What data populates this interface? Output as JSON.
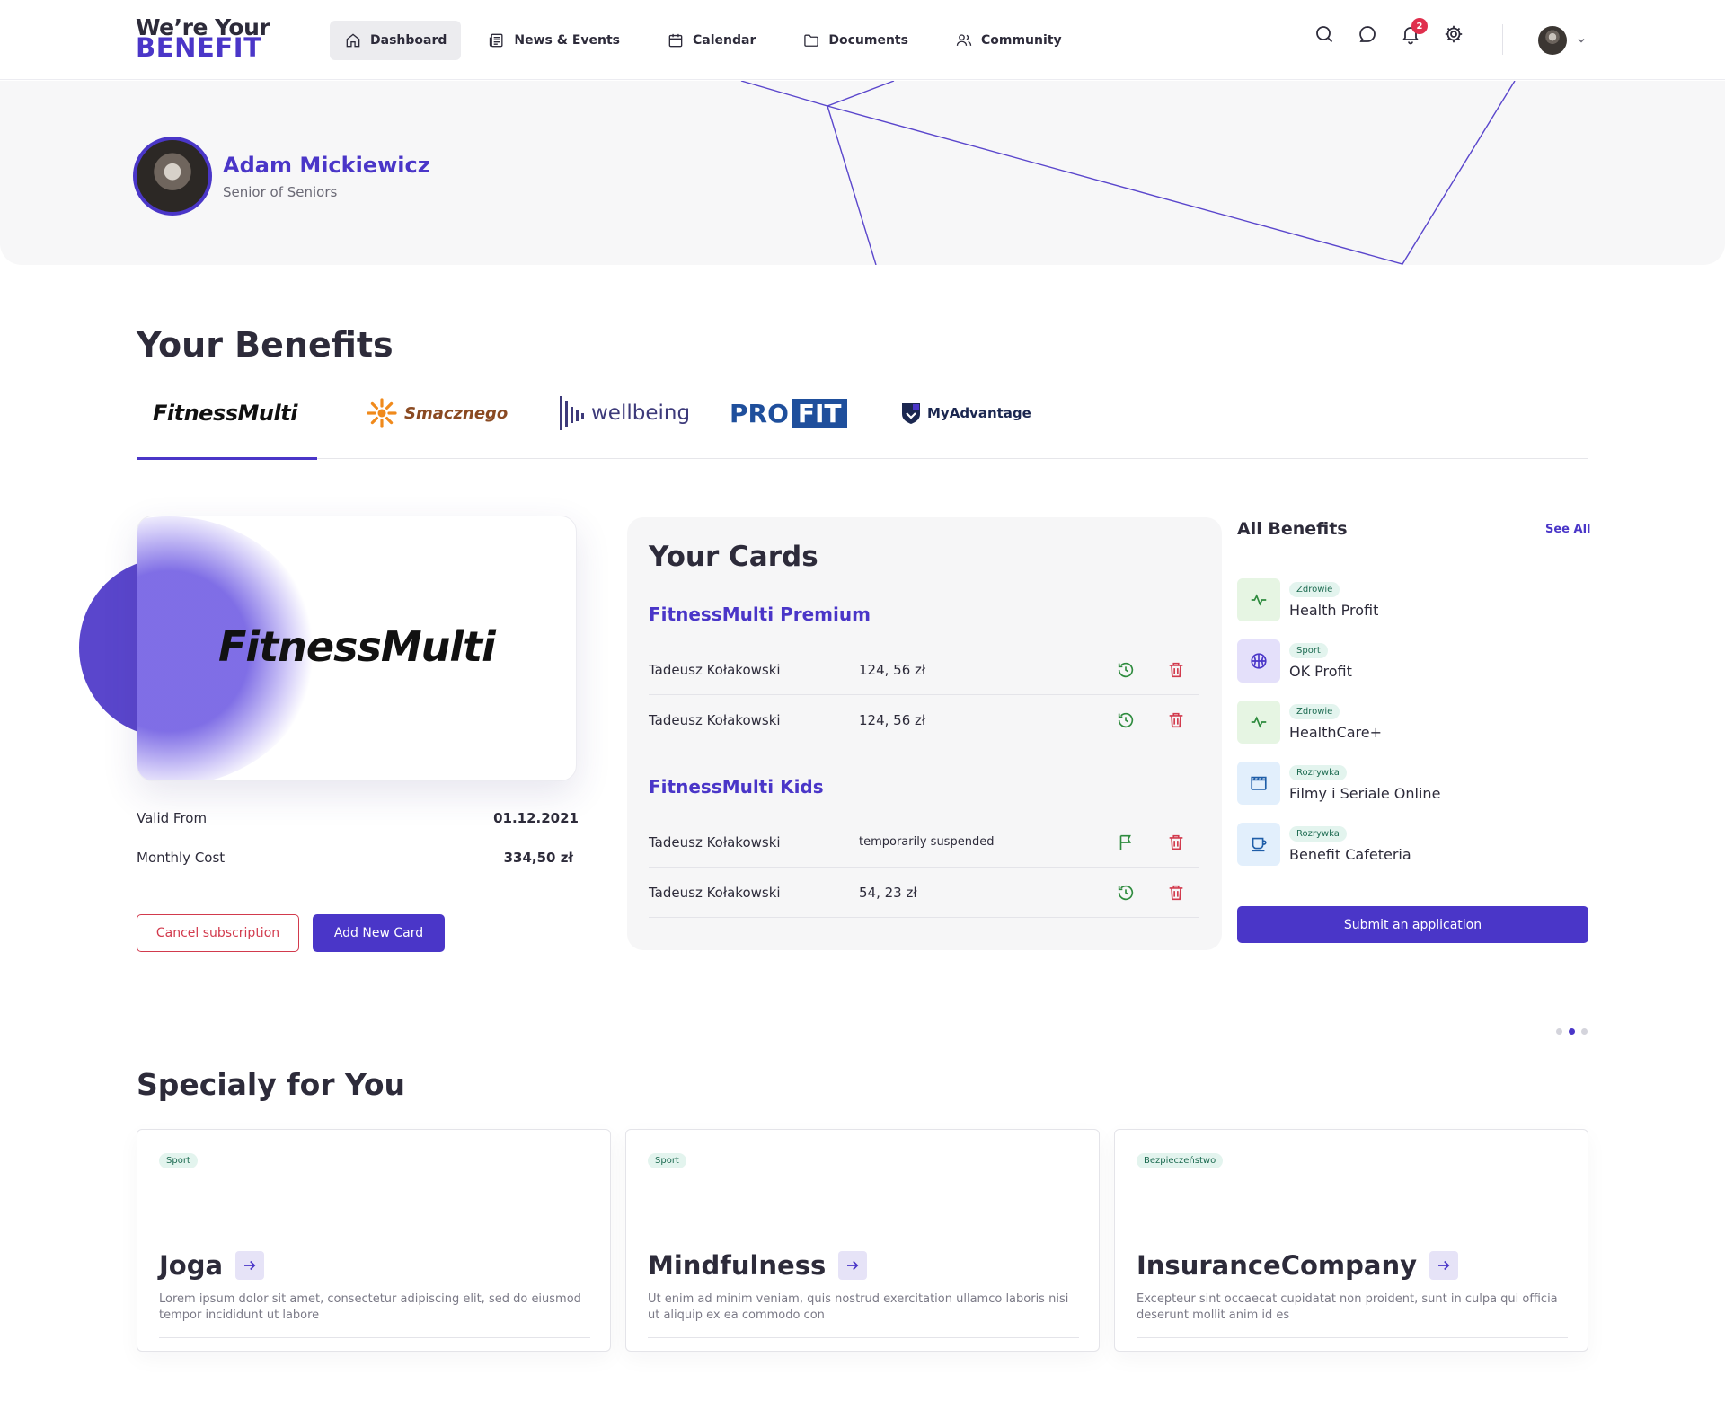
{
  "logo": {
    "line1": "We’re Your",
    "line2": "BENEFIT"
  },
  "nav": [
    {
      "label": "Dashboard",
      "icon": "home-icon"
    },
    {
      "label": "News & Events",
      "icon": "newspaper-icon"
    },
    {
      "label": "Calendar",
      "icon": "calendar-icon"
    },
    {
      "label": "Documents",
      "icon": "folder-icon"
    },
    {
      "label": "Community",
      "icon": "users-icon"
    }
  ],
  "notifications": {
    "count": "2"
  },
  "profile": {
    "name": "Adam Mickiewicz",
    "role": "Senior of Seniors"
  },
  "benefits": {
    "title": "Your Benefits",
    "brands": [
      "FitnessMulti",
      "Smacznego",
      "wellbeing",
      "PRO",
      "FIT",
      "MyAdvantage"
    ],
    "active_brand": "FitnessMulti"
  },
  "card": {
    "name": "FitnessMulti",
    "valid_from_label": "Valid From",
    "valid_from": "01.12.2021",
    "monthly_cost_label": "Monthly Cost",
    "monthly_cost": "334,50 zł",
    "cancel_label": "Cancel subscription",
    "add_label": "Add New Card"
  },
  "your_cards": {
    "title": "Your Cards",
    "groups": [
      {
        "name": "FitnessMulti Premium",
        "rows": [
          {
            "holder": "Tadeusz Kołakowski",
            "amount": "124, 56 zł",
            "action": "history"
          },
          {
            "holder": "Tadeusz Kołakowski",
            "amount": "124, 56 zł",
            "action": "history"
          }
        ]
      },
      {
        "name": "FitnessMulti Kids",
        "rows": [
          {
            "holder": "Tadeusz Kołakowski",
            "amount": "temporarily suspended",
            "action": "flag"
          },
          {
            "holder": "Tadeusz Kołakowski",
            "amount": "54, 23 zł",
            "action": "history"
          }
        ]
      }
    ]
  },
  "all_benefits": {
    "title": "All Benefits",
    "see_all": "See All",
    "items": [
      {
        "tag": "Zdrowie",
        "label": "Health Profit",
        "icon": "pulse-icon",
        "color": "#e6f5e3"
      },
      {
        "tag": "Sport",
        "label": "OK Profit",
        "icon": "basketball-icon",
        "color": "#e4e0fa"
      },
      {
        "tag": "Zdrowie",
        "label": "HealthCare+",
        "icon": "pulse-icon",
        "color": "#e6f5e3"
      },
      {
        "tag": "Rozrywka",
        "label": "Filmy i Seriale Online",
        "icon": "clapperboard-icon",
        "color": "#e2effc"
      },
      {
        "tag": "Rozrywka",
        "label": "Benefit Cafeteria",
        "icon": "coffee-cup-icon",
        "color": "#e2effc"
      }
    ],
    "submit_label": "Submit an application"
  },
  "special": {
    "title": "Specialy for You",
    "cards": [
      {
        "tag": "Sport",
        "title": "Joga",
        "desc": "Lorem ipsum dolor sit amet, consectetur adipiscing elit, sed do eiusmod tempor incididunt ut labore"
      },
      {
        "tag": "Sport",
        "title": "Mindfulness",
        "desc": "Ut enim ad minim veniam, quis nostrud exercitation ullamco laboris nisi ut aliquip ex ea commodo con"
      },
      {
        "tag": "Bezpieczeństwo",
        "title": "InsuranceCompany",
        "desc": "Excepteur sint occaecat cupidatat non proident, sunt in culpa qui officia deserunt mollit anim id es"
      }
    ]
  },
  "colors": {
    "accent": "#4a36c8",
    "danger": "#d23a4d",
    "success": "#2e8b3e"
  }
}
